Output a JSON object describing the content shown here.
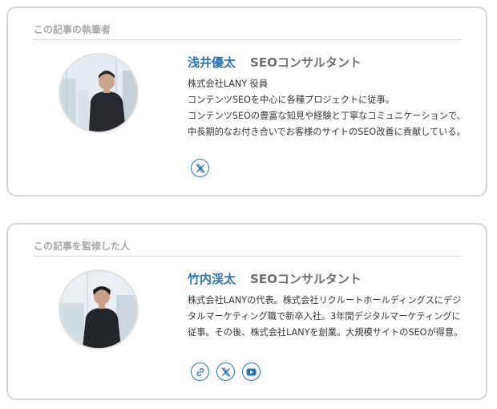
{
  "cards": [
    {
      "heading": "この記事の執筆者",
      "name": "浅井優太",
      "role": "SEOコンサルタント",
      "bio": [
        "株式会社LANY 役員",
        "コンテンツSEOを中心に各種プロジェクトに従事。",
        "コンテンツSEOの豊富な知見や経験と丁寧なコミュニケーションで、中長期的なお付き合いでお客様のサイトのSEO改善に貢献している。"
      ],
      "social": [
        "x-icon"
      ]
    },
    {
      "heading": "この記事を監修した人",
      "name": "竹内渓太",
      "role": "SEOコンサルタント",
      "bio": [
        "株式会社LANYの代表。株式会社リクルートホールディングスにデジタルマーケティング職で新卒入社。3年間デジタルマーケティングに従事。その後、株式会社LANYを創業。大規模サイトのSEOが得意。"
      ],
      "social": [
        "link-icon",
        "x-icon",
        "youtube-icon"
      ]
    }
  ],
  "colors": {
    "accent": "#2a73b8",
    "heading": "#a7a7a7",
    "border": "#d6d6d6"
  }
}
